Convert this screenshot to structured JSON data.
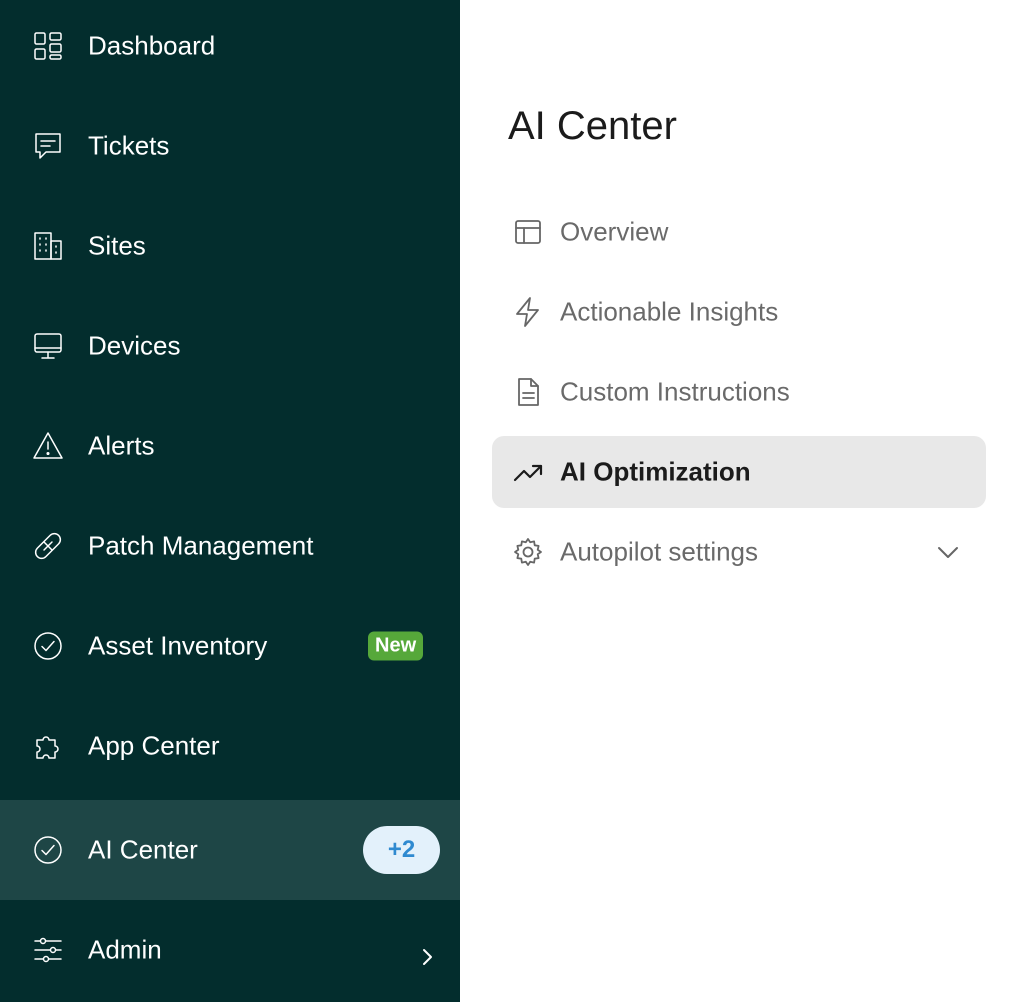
{
  "sidebar": {
    "items": [
      {
        "label": "Dashboard",
        "icon": "dashboard-icon"
      },
      {
        "label": "Tickets",
        "icon": "ticket-message-icon"
      },
      {
        "label": "Sites",
        "icon": "building-icon"
      },
      {
        "label": "Devices",
        "icon": "monitor-icon"
      },
      {
        "label": "Alerts",
        "icon": "warning-triangle-icon"
      },
      {
        "label": "Patch Management",
        "icon": "bandage-icon"
      },
      {
        "label": "Asset Inventory",
        "icon": "check-circle-icon",
        "badge": "New"
      },
      {
        "label": "App Center",
        "icon": "puzzle-icon"
      },
      {
        "label": "AI Center",
        "icon": "check-circle-icon",
        "badge": "+2",
        "active": true
      },
      {
        "label": "Admin",
        "icon": "sliders-icon"
      }
    ]
  },
  "panel": {
    "title": "AI Center",
    "items": [
      {
        "label": "Overview",
        "icon": "layout-icon"
      },
      {
        "label": "Actionable Insights",
        "icon": "lightning-icon"
      },
      {
        "label": "Custom Instructions",
        "icon": "document-icon"
      },
      {
        "label": "AI Optimization",
        "icon": "trending-up-icon",
        "active": true
      },
      {
        "label": "Autopilot settings",
        "icon": "gear-icon"
      }
    ]
  },
  "colors": {
    "sidebar_bg": "#032d2d",
    "sidebar_active_bg": "#1e4646",
    "badge_new": "#56a83a",
    "badge_count_bg": "#e3f1fb",
    "badge_count_text": "#2f8ad0",
    "panel_active_bg": "#e8e8e8"
  }
}
